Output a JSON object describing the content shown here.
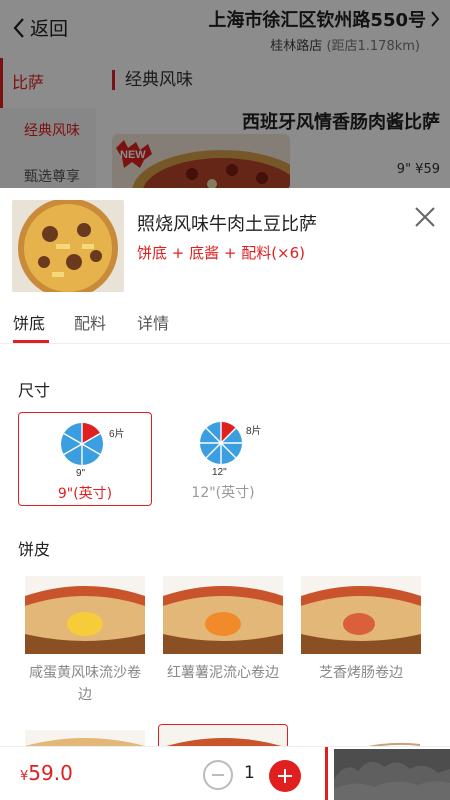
{
  "header": {
    "back_label": "返回",
    "address": "上海市徐汇区钦州路550号",
    "store": "桂林路店",
    "distance": "(距店1.178km)"
  },
  "category": {
    "main": "比萨",
    "sub": [
      "经典风味",
      "甄选尊享"
    ]
  },
  "section_title": "经典风味",
  "bg_product": {
    "name": "西班牙风情香肠肉酱比萨",
    "badge": "NEW",
    "price": "9\" ¥59"
  },
  "sheet": {
    "title": "照烧风味牛肉土豆比萨",
    "subtitle": "饼底 + 底酱 + 配料(×6)",
    "tabs": [
      "饼底",
      "配料",
      "详情"
    ],
    "size_label": "尺寸",
    "sizes": [
      {
        "label": "9\"(英寸)",
        "slices": "6片",
        "inch": "9\"",
        "selected": true
      },
      {
        "label": "12\"(英寸)",
        "slices": "8片",
        "inch": "12\"",
        "selected": false
      }
    ],
    "crust_label": "饼皮",
    "crusts": [
      {
        "name": "咸蛋黄风味流沙卷边"
      },
      {
        "name": "红薯薯泥流心卷边"
      },
      {
        "name": "芝香烤肠卷边"
      }
    ]
  },
  "bottom": {
    "currency": "¥",
    "price": "59.0",
    "quantity": "1"
  },
  "colors": {
    "accent": "#e02020",
    "dim_overlay": "rgba(0,0,0,0.45)"
  },
  "icons": [
    "back-chevron-icon",
    "chevron-right-icon",
    "close-icon",
    "minus-icon",
    "plus-icon"
  ]
}
